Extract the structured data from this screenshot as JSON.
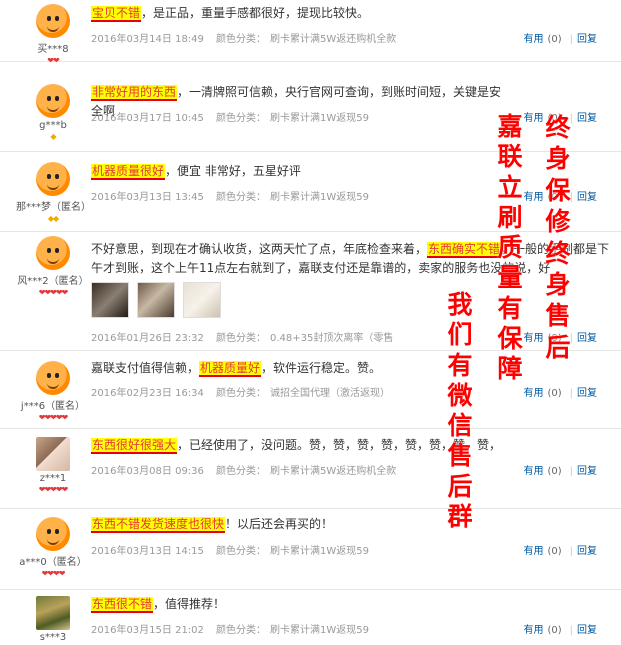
{
  "actions": {
    "useful": "有用",
    "count": "(0)",
    "reply": "回复"
  },
  "reviews": [
    {
      "user": "买***8",
      "text_parts": [
        [
          "宝贝不错",
          true
        ],
        [
          "，是正品，重量手感都很好，提现比较快。",
          false
        ]
      ],
      "date": "2016年03月14日 18:49",
      "color_label": "颜色分类：",
      "color_value": "刷卡累计满5W返还购机全款",
      "rank": "❤❤"
    },
    {
      "user": "g***b",
      "text_parts": [
        [
          "非常好用的东西",
          true
        ],
        [
          "，一清牌照可信赖，央行官网可查询，到账时间短，关键是安全啊",
          false
        ]
      ],
      "date": "2016年03月17日 10:45",
      "color_label": "颜色分类：",
      "color_value": "刷卡累计满1W返现59",
      "rank": "◆"
    },
    {
      "user": "那***梦（匿名）",
      "text_parts": [
        [
          "机器质量很好",
          true
        ],
        [
          "，便宜 非常好，五星好评",
          false
        ]
      ],
      "date": "2016年03月13日 13:45",
      "color_label": "颜色分类：",
      "color_value": "刷卡累计满1W返现59",
      "rank": "◆◆"
    },
    {
      "user": "风***2（匿名）",
      "text_parts": [
        [
          "不好意思，到现在才确认收货，这两天忙了点，年底检查来着，",
          false
        ],
        [
          "东西确实不错",
          true
        ],
        [
          "，一般的手刷都是下午才到账，这个上午11点左右就到了，嘉联支付还是靠谱的，卖家的服务也没的说，好",
          false
        ]
      ],
      "date": "2016年01月26日 23:32",
      "color_label": "颜色分类：",
      "color_value": "0.48+35封顶次离率（零售",
      "rank": "❤❤❤❤❤"
    },
    {
      "user": "j***6（匿名）",
      "text_parts": [
        [
          "嘉联支付值得信赖，",
          false
        ],
        [
          "机器质量好",
          true
        ],
        [
          "，软件运行稳定。赞。",
          false
        ]
      ],
      "date": "2016年02月23日 16:34",
      "color_label": "颜色分类：",
      "color_value": "诚招全国代理（激活返现）",
      "rank": "❤❤❤❤❤"
    },
    {
      "user": "z***1",
      "text_parts": [
        [
          "东西很好很强大",
          true
        ],
        [
          "，已经使用了，没问题。赞，赞，赞，赞，赞，赞，赞，赞，",
          false
        ]
      ],
      "date": "2016年03月08日 09:36",
      "color_label": "颜色分类：",
      "color_value": "刷卡累计满5W返还购机全款",
      "rank": "❤❤❤❤❤"
    },
    {
      "user": "a***0（匿名）",
      "text_parts": [
        [
          "东西不错发货速度也很快",
          true
        ],
        [
          "！以后还会再买的！",
          false
        ]
      ],
      "date": "2016年03月13日 14:15",
      "color_label": "颜色分类：",
      "color_value": "刷卡累计满1W返现59",
      "rank": "❤❤❤❤"
    },
    {
      "user": "s***3",
      "text_parts": [
        [
          "东西很不错",
          true
        ],
        [
          "，值得推荐！",
          false
        ]
      ],
      "date": "2016年03月15日 21:02",
      "color_label": "颜色分类：",
      "color_value": "刷卡累计满1W返现59",
      "rank": ""
    }
  ],
  "overlay": {
    "col1": "终身保修终身售后",
    "col2": "嘉联立刷质量有保障",
    "col3": "我们有微信售后群"
  },
  "colors": {
    "highlight_bg": "#ffff00",
    "highlight_text": "#e4393c",
    "link": "#005aa0",
    "overlay_red": "#ff0000"
  }
}
